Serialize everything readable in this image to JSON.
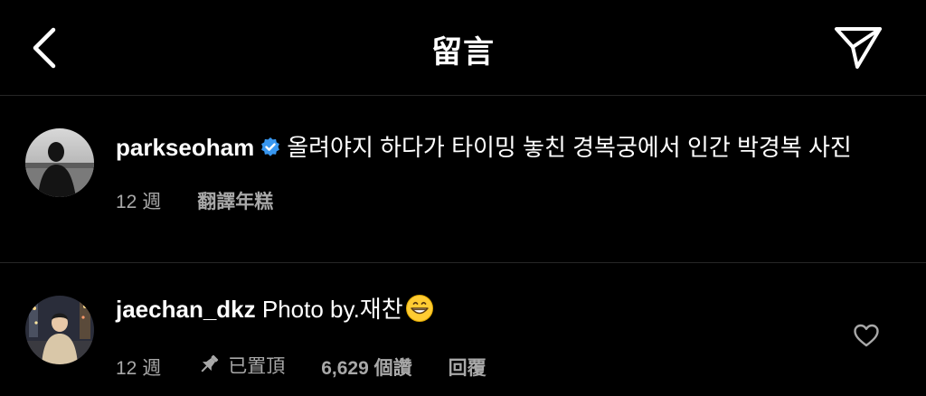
{
  "header": {
    "title": "留言",
    "back_icon": "chevron-left-icon",
    "share_icon": "paper-plane-icon"
  },
  "caption": {
    "username": "parkseoham",
    "verified_icon": "verified-badge-icon",
    "text": "올려야지 하다가 타이밍 놓친 경복궁에서 인간 박경복 사진",
    "time": "12 週",
    "translate_label": "翻譯年糕"
  },
  "comment": {
    "username": "jaechan_dkz",
    "text": "Photo by.재찬",
    "emoji_icon": "grinning-face-emoji",
    "time": "12 週",
    "pin_icon": "pin-icon",
    "pinned_label": "已置頂",
    "likes_label": "6,629 個讚",
    "reply_label": "回覆",
    "heart_icon": "heart-outline-icon"
  },
  "colors": {
    "background": "#000000",
    "text": "#ffffff",
    "secondary_text": "#a8a8a8",
    "divider": "#262626",
    "verified": "#3897f0",
    "emoji": "#ffcc33"
  }
}
